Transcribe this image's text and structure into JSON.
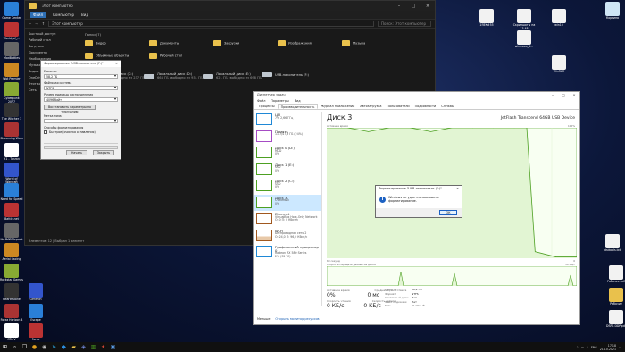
{
  "desktop": {
    "left_icons": [
      "Game Center",
      "World_of_...",
      "ModBattles",
      "Wot Premier",
      "Cyberpunk 2077",
      "The Witcher 3",
      "Streaming Wars",
      "X1 - Tarzan",
      "World of Warcraft",
      "Need for Speed",
      "Battle.net",
      "KarDAD Repack",
      "Aerial Racing",
      "Rockstar Games",
      "Hearthstone",
      "Forza Horizon 4",
      "GTA V",
      "Genshin",
      "Escape",
      "Forza"
    ],
    "top_right_icons": [
      "Корзина",
      "1ЯЕК#55",
      "Скриншоты на 13.48",
      "win10",
      "windows_1...",
      "WinRAR",
      "dsttools.txt"
    ],
    "bottom_right_icons": [
      "Рабочее.pdf",
      "Рабочие",
      "DSPS DDP.pdf"
    ]
  },
  "explorer": {
    "title": "Этот компьютер",
    "ribbon_tabs": [
      "Файл",
      "Компьютер",
      "Вид"
    ],
    "address": "Этот компьютер",
    "search_placeholder": "Поиск: Этот компьютер",
    "nav_items": [
      "Быстрый доступ",
      "Рабочий стол",
      "Загрузки",
      "Документы",
      "Изображения",
      "Музыка",
      "Видео",
      "OneDrive",
      "Этот компьютер",
      "Сеть"
    ],
    "folders_header": "Папки (7)",
    "folders": [
      "Видео",
      "Документы",
      "Загрузки",
      "Изображения",
      "Музыка",
      "Объемные объекты",
      "Рабочий стол"
    ],
    "drives": [
      {
        "name": "Локальный диск (C:)",
        "free": "96,4 ГБ свободно из 237 ГБ"
      },
      {
        "name": "Локальный диск (D:)",
        "free": "664 ГБ свободно из 931 ГБ"
      },
      {
        "name": "Локальный диск (E:)",
        "free": "621 ГБ свободно из 698 ГБ"
      },
      {
        "name": "USB-накопитель (F:)",
        "free": ""
      }
    ],
    "status": "Элементов: 12 | Выбран 1 элемент"
  },
  "format_dialog": {
    "title": "Форматирование \"USB-накопитель (F:)\"",
    "capacity_label": "Емкость:",
    "capacity_value": "58,2 ГБ",
    "fs_label": "Файловая система",
    "fs_value": "NTFS",
    "unit_label": "Размер единицы распределения",
    "unit_value": "4096 байт",
    "restore_btn": "Восстановить параметры по умолчанию",
    "volume_label": "Метка тома",
    "volume_value": "",
    "methods_label": "Способы форматирования",
    "quick_format": "Быстрое (очистка оглавления)",
    "start_btn": "Начать",
    "close_btn": "Закрыть"
  },
  "taskmanager": {
    "title": "Диспетчер задач",
    "menu": [
      "Файл",
      "Параметры",
      "Вид"
    ],
    "tabs": [
      "Процессы",
      "Производительность",
      "Журнал приложений",
      "Автозагрузка",
      "Пользователи",
      "Подробности",
      "Службы"
    ],
    "active_tab": "Производительность",
    "sidebar": [
      {
        "name": "ЦП",
        "line1": "7% 2,66 ГГц",
        "line2": "",
        "color": "#1f88d6"
      },
      {
        "name": "Память",
        "line1": "11,7/47,9 ГБ (24%)",
        "line2": "",
        "color": "#a64cc4"
      },
      {
        "name": "Диск 0 (D:)",
        "line1": "HDD",
        "line2": "0%",
        "color": "#4da022"
      },
      {
        "name": "Диск 1 (E:)",
        "line1": "SSD",
        "line2": "0%",
        "color": "#4da022"
      },
      {
        "name": "Диск 2 (C:)",
        "line1": "SSD",
        "line2": "0%",
        "color": "#4da022"
      },
      {
        "name": "Диск 3",
        "line1": "Съемный",
        "line2": "0%",
        "color": "#4da022"
      },
      {
        "name": "Ethernet",
        "line1": "VirtualBox Host-Only Network",
        "line2": "О: 0 П: 0 Кбит/с",
        "color": "#a0581f"
      },
      {
        "name": "Wi-Fi",
        "line1": "Беспроводная сеть 2",
        "line2": "О: 24,0 П: 96,0 Кбит/с",
        "color": "#a0581f"
      },
      {
        "name": "Графический процессор 0",
        "line1": "Radeon RX 580 Series",
        "line2": "2% (32 °C)",
        "color": "#1f88d6"
      }
    ],
    "active_index": 5,
    "disk_title": "Диск 3",
    "device_name": "JetFlash Transcend 64GB USB Device",
    "graph_label_top": "Активное время",
    "graph_max": "100%",
    "graph_time": "60 секунд",
    "graph_min": "0",
    "speed_label": "Скорость передачи данных на диске",
    "speed_max": "10 КБ/с",
    "active_time_label": "Активное время",
    "active_time": "0%",
    "avg_response_label": "Среднее время ответа",
    "avg_response": "0 мс",
    "read_label": "Скорость чтения",
    "read_value": "0 КБ/с",
    "write_label": "Скорость записи",
    "write_value": "0 КБ/с",
    "props": [
      {
        "k": "Емкость:",
        "v": "58,2 ГБ"
      },
      {
        "k": "Формат:",
        "v": "NTFS"
      },
      {
        "k": "Системный диск:",
        "v": "Нет"
      },
      {
        "k": "Файл подкачки:",
        "v": "Нет"
      },
      {
        "k": "Тип:",
        "v": "Съемный"
      }
    ],
    "less_btn": "Меньше",
    "resmon_link": "Открыть монитор ресурсов"
  },
  "message_box": {
    "title": "Форматирование \"USB-накопитель (F:)\"",
    "text": "Windows не удается завершить форматирование.",
    "ok": "ОК"
  },
  "taskbar": {
    "lang": "ENG",
    "time": "17:18",
    "date": "21.10.2021"
  },
  "chart_data": {
    "type": "line",
    "title": "Активное время",
    "ylim": [
      0,
      100
    ],
    "x": [
      0,
      5,
      10,
      15,
      20,
      25,
      30,
      35,
      40,
      45,
      48,
      50,
      55,
      60
    ],
    "series": [
      {
        "values": [
          100,
          100,
          97,
          100,
          100,
          97,
          100,
          100,
          100,
          100,
          100,
          5,
          1,
          1
        ]
      }
    ]
  }
}
